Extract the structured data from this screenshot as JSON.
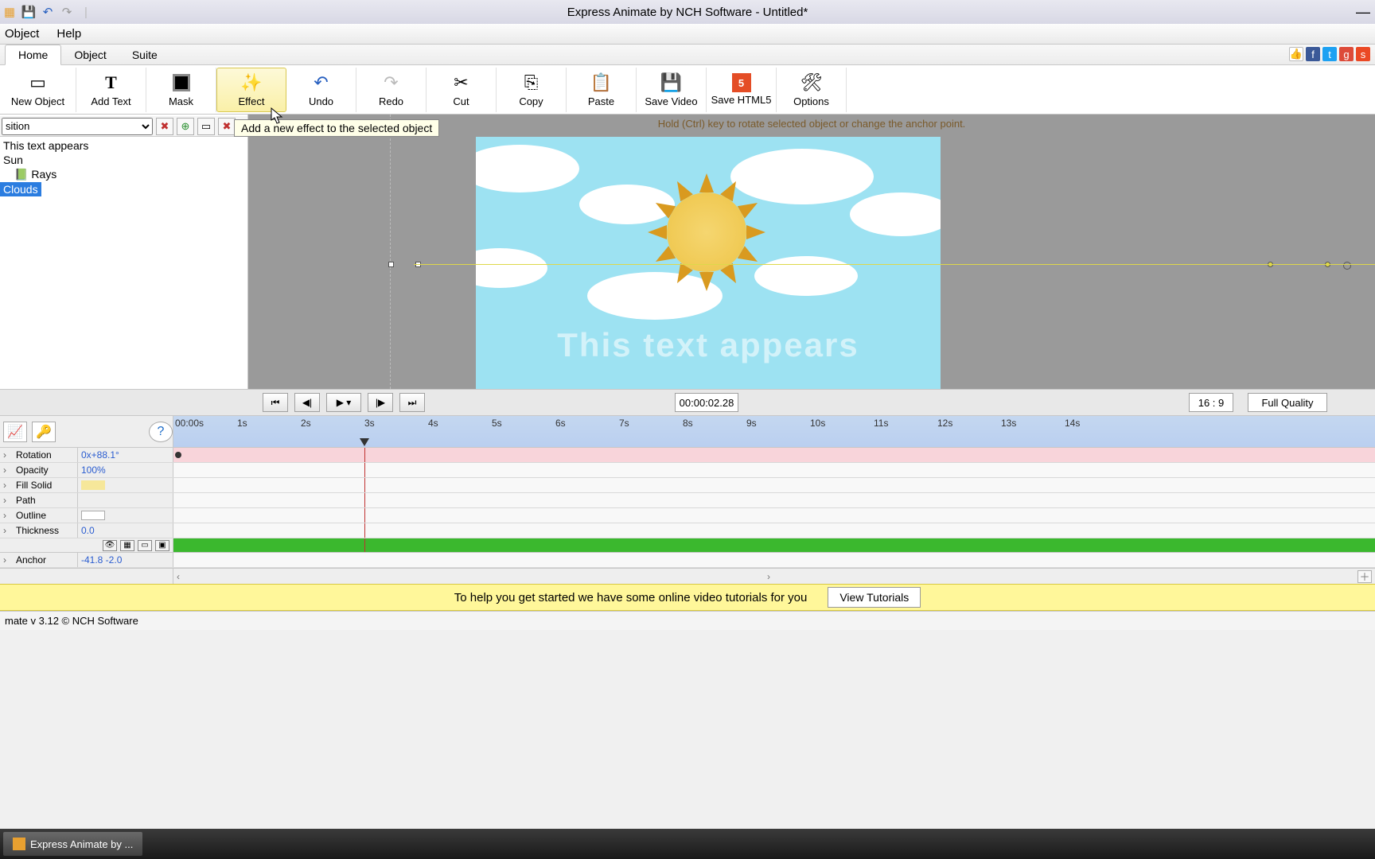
{
  "title": "Express Animate by NCH Software - Untitled*",
  "menus": {
    "object": "Object",
    "help": "Help"
  },
  "tabs": {
    "home": "Home",
    "object": "Object",
    "suite": "Suite"
  },
  "ribbon": {
    "new_object": "New Object",
    "add_text": "Add Text",
    "mask": "Mask",
    "effect": "Effect",
    "undo": "Undo",
    "redo": "Redo",
    "cut": "Cut",
    "copy": "Copy",
    "paste": "Paste",
    "save_video": "Save Video",
    "save_html5": "Save HTML5",
    "options": "Options"
  },
  "tooltip": "Add a new effect to the selected object",
  "canvas_hint": "Hold (Ctrl) key to rotate selected object or change the anchor point.",
  "selector_value": "sition",
  "layers": {
    "text": "This text appears",
    "sun": "Sun",
    "rays": "Rays",
    "clouds": "Clouds"
  },
  "stage_text": "This text appears",
  "timecode": "00:00:02.28",
  "aspect": "16 : 9",
  "quality": "Full Quality",
  "ruler": [
    "00:00s",
    "1s",
    "2s",
    "3s",
    "4s",
    "5s",
    "6s",
    "7s",
    "8s",
    "9s",
    "10s",
    "11s",
    "12s",
    "13s",
    "14s"
  ],
  "props": {
    "rotation": {
      "label": "Rotation",
      "value": "0x+88.1°"
    },
    "opacity": {
      "label": "Opacity",
      "value": "100%"
    },
    "fill": {
      "label": "Fill Solid"
    },
    "path": {
      "label": "Path"
    },
    "outline": {
      "label": "Outline"
    },
    "thickness": {
      "label": "Thickness",
      "value": "0.0"
    },
    "anchor": {
      "label": "Anchor",
      "value": "-41.8  -2.0"
    }
  },
  "tutorial": {
    "text": "To help you get started we have some online video tutorials for you",
    "button": "View Tutorials"
  },
  "status": "mate v 3.12 © NCH Software",
  "taskbar": "Express Animate by ..."
}
